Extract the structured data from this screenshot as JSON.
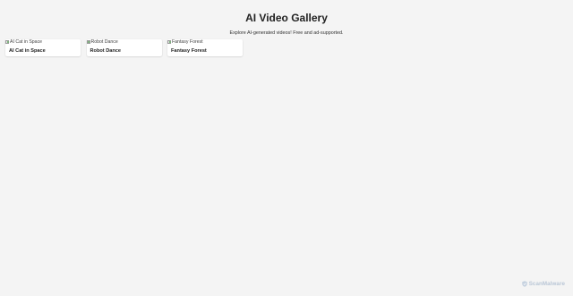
{
  "header": {
    "title": "AI Video Gallery",
    "subtitle": "Explore AI-generated videos! Free and ad-supported."
  },
  "gallery": {
    "items": [
      {
        "alt": "AI Cat in Space",
        "title": "AI Cat in Space"
      },
      {
        "alt": "Robot Dance",
        "title": "Robot Dance"
      },
      {
        "alt": "Fantasy Forest",
        "title": "Fantasy Forest"
      }
    ]
  },
  "watermark": {
    "label": "ScanMalware",
    "color": "#b9c6d6"
  },
  "colors": {
    "background": "#f4f4f4",
    "card": "#ffffff",
    "text": "#222222"
  }
}
